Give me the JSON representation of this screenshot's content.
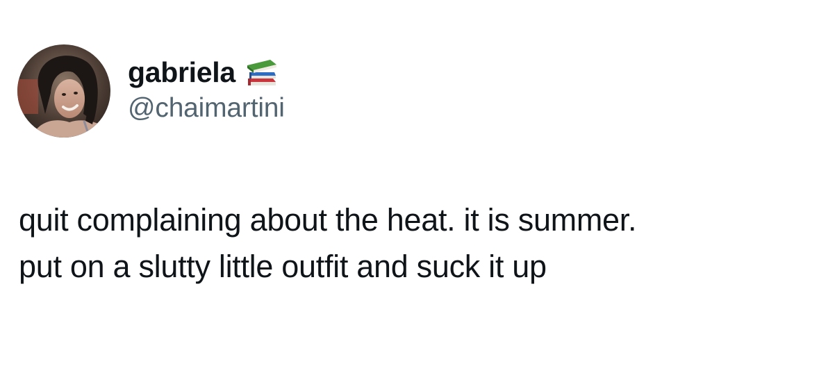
{
  "author": {
    "display_name": "gabriela",
    "handle": "@chaimartini",
    "name_emoji": "books-icon"
  },
  "tweet": {
    "lines": [
      "quit complaining about the heat. it is summer.",
      "put on a slutty little outfit and suck it up"
    ]
  },
  "colors": {
    "text_primary": "#0f1419",
    "text_secondary": "#536471",
    "background": "#ffffff"
  }
}
